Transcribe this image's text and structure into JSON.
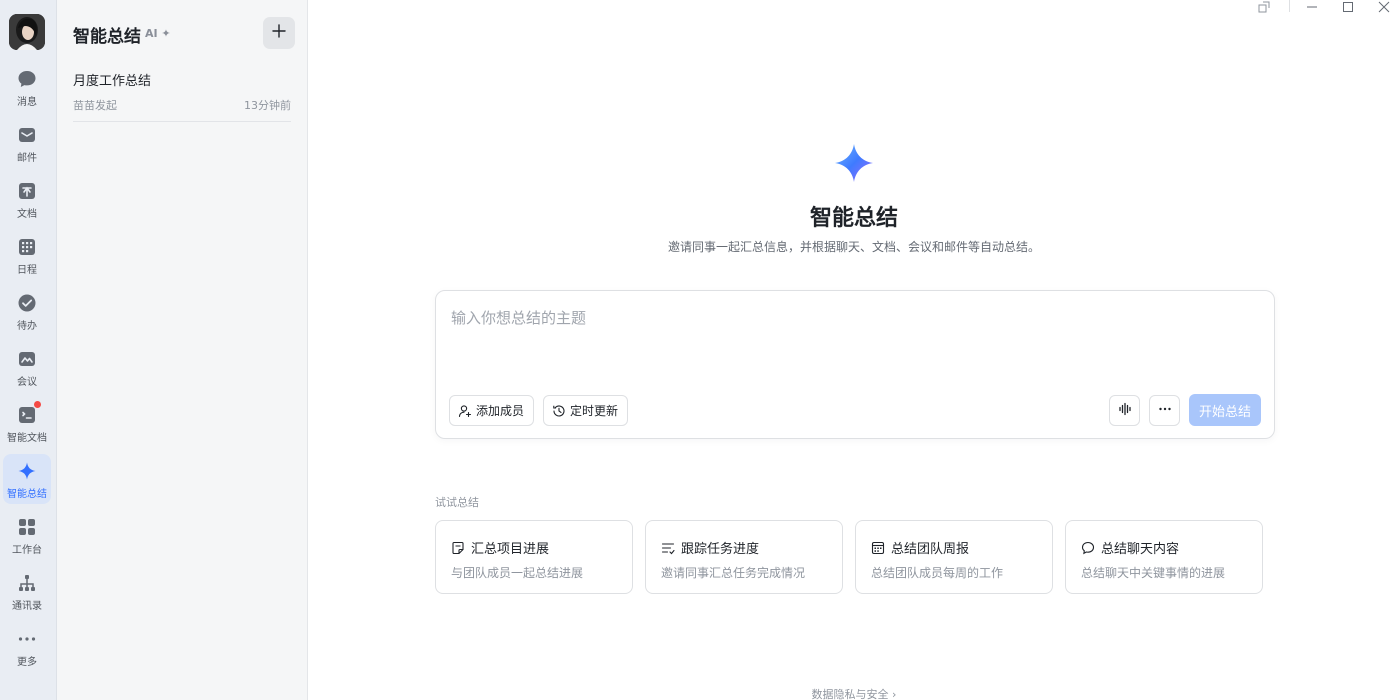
{
  "nav": {
    "items": [
      {
        "label": "消息",
        "icon": "message-icon"
      },
      {
        "label": "邮件",
        "icon": "mail-icon"
      },
      {
        "label": "文档",
        "icon": "docs-icon"
      },
      {
        "label": "日程",
        "icon": "calendar-icon"
      },
      {
        "label": "待办",
        "icon": "todo-icon"
      },
      {
        "label": "会议",
        "icon": "meeting-icon"
      },
      {
        "label": "智能文档",
        "icon": "smart-doc-icon"
      },
      {
        "label": "智能总结",
        "icon": "sparkle-icon",
        "active": true
      },
      {
        "label": "工作台",
        "icon": "workplace-icon"
      },
      {
        "label": "通讯录",
        "icon": "contacts-icon"
      },
      {
        "label": "更多",
        "icon": "more-icon"
      }
    ]
  },
  "panel": {
    "title": "智能总结",
    "ai_tag": "AI ✦",
    "conversations": [
      {
        "title": "月度工作总结",
        "initiator": "苗苗发起",
        "time": "13分钟前"
      }
    ]
  },
  "main": {
    "title": "智能总结",
    "subtitle": "邀请同事一起汇总信息，并根据聊天、文档、会议和邮件等自动总结。",
    "input_placeholder": "输入你想总结的主题",
    "add_member_label": "添加成员",
    "schedule_update_label": "定时更新",
    "start_label": "开始总结",
    "try_label": "试试总结",
    "suggestions": [
      {
        "title": "汇总项目进展",
        "desc": "与团队成员一起总结进展",
        "icon": "note-icon"
      },
      {
        "title": "跟踪任务进度",
        "desc": "邀请同事汇总任务完成情况",
        "icon": "task-list-icon"
      },
      {
        "title": "总结团队周报",
        "desc": "总结团队成员每周的工作",
        "icon": "calendar-grid-icon"
      },
      {
        "title": "总结聊天内容",
        "desc": "总结聊天中关键事情的进展",
        "icon": "chat-bubble-icon"
      }
    ],
    "footer_link": "数据隐私与安全 ›"
  },
  "colors": {
    "accent": "#3370ff",
    "start_button_disabled": "#a9c6fb",
    "badge": "#f54a45"
  }
}
